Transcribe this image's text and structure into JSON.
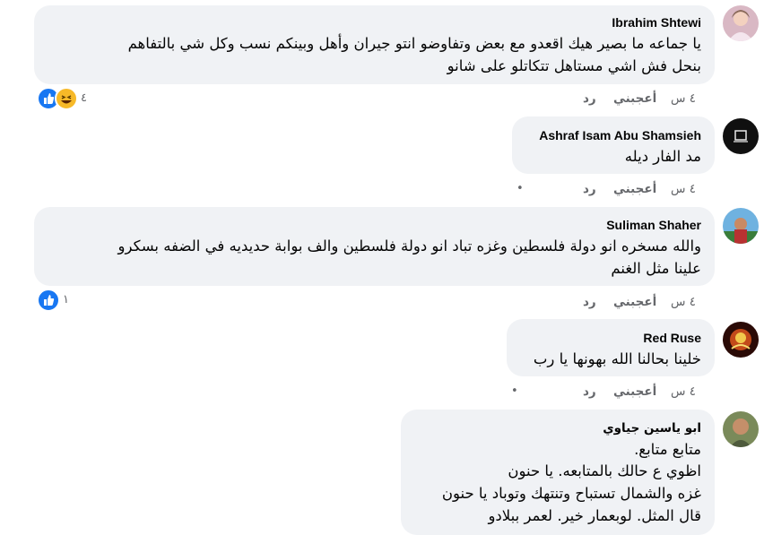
{
  "comments": [
    {
      "author": "Ibrahim Shtewi",
      "lines": [
        "يا جماعه ما بصير هيك اقعدو مع بعض وتفاوضو انتو جيران وأهل وبينكم نسب وكل شي بالتفاهم",
        "بنحل فش اشي مستاهل تتكاتلو على شانو"
      ],
      "time": "٤ س",
      "like": "أعجبني",
      "reply": "رد",
      "reaction_count": "٤"
    },
    {
      "author": "Ashraf Isam Abu Shamsieh",
      "lines": [
        "مد الفار ديله"
      ],
      "time": "٤ س",
      "like": "أعجبني",
      "reply": "رد"
    },
    {
      "author": "Suliman Shaher",
      "lines": [
        "والله مسخره انو دولة فلسطين وغزه تباد انو دولة فلسطين والف بوابة حديديه في الضفه بسكرو",
        "علينا مثل الغنم"
      ],
      "time": "٤ س",
      "like": "أعجبني",
      "reply": "رد",
      "reaction_count": "١"
    },
    {
      "author": "Red Ruse",
      "lines": [
        "خلينا بحالنا الله بهونها يا رب"
      ],
      "time": "٤ س",
      "like": "أعجبني",
      "reply": "رد"
    },
    {
      "author": "ابو ياسين جياوي",
      "lines": [
        "متابع متابع.",
        "اظوي ع حالك بالمتابعه. يا حنون",
        "غزه والشمال تستباح وتنتهك وتوباد يا حنون",
        "قال المثل. لوبعمار خير. لعمر ببلادو"
      ]
    }
  ],
  "dot": "•",
  "colors": {
    "bubble": "#f0f2f5",
    "meta": "#65676b",
    "like_blue": "#1877f2",
    "haha_yellow": "#f7b928"
  },
  "icons": {
    "like": "thumbs-up-icon",
    "haha": "laughing-face-icon"
  }
}
